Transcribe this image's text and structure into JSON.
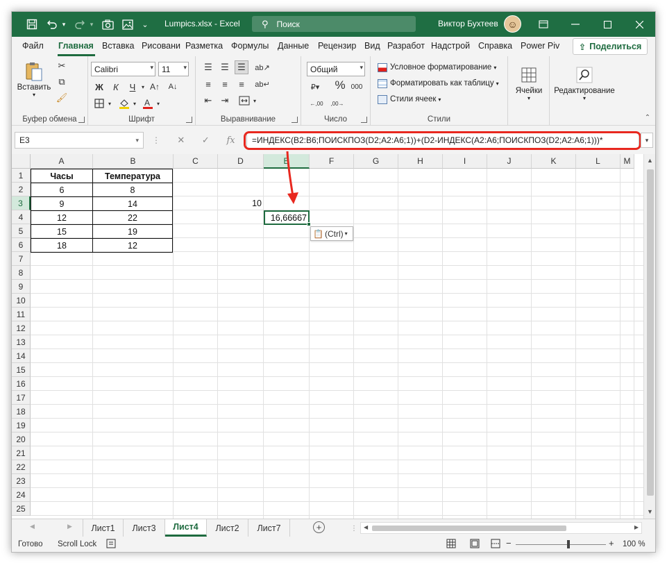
{
  "titlebar": {
    "doc_title": "Lumpics.xlsx  -  Excel",
    "search_placeholder": "Поиск",
    "user_name": "Виктор Бухтеев",
    "accent": "#1f6e43"
  },
  "menu": {
    "tabs": [
      "Файл",
      "Главная",
      "Вставка",
      "Рисовани",
      "Разметка",
      "Формулы",
      "Данные",
      "Рецензир",
      "Вид",
      "Разработ",
      "Надстрой",
      "Справка",
      "Power Piv"
    ],
    "active_tab": "Главная",
    "share_label": "Поделиться"
  },
  "ribbon": {
    "clipboard": {
      "paste_label": "Вставить",
      "group_label": "Буфер обмена"
    },
    "font": {
      "font_name": "Calibri",
      "font_size": "11",
      "bold": "Ж",
      "italic": "К",
      "underline": "Ч",
      "group_label": "Шрифт"
    },
    "alignment": {
      "group_label": "Выравнивание"
    },
    "number": {
      "format": "Общий",
      "group_label": "Число"
    },
    "styles": {
      "conditional": "Условное форматирование",
      "as_table": "Форматировать как таблицу",
      "cell_styles": "Стили ячеек",
      "group_label": "Стили"
    },
    "cells": {
      "label": "Ячейки"
    },
    "editing": {
      "label": "Редактирование"
    }
  },
  "formula_bar": {
    "name_box": "E3",
    "formula": "=ИНДЕКС(B2:B6;ПОИСКПОЗ(D2;A2:A6;1))+(D2-ИНДЕКС(A2:A6;ПОИСКПОЗ(D2;A2:A6;1)))*"
  },
  "grid": {
    "columns": [
      "A",
      "B",
      "C",
      "D",
      "E",
      "F",
      "G",
      "H",
      "I",
      "J",
      "K",
      "L",
      "M"
    ],
    "rows": [
      "1",
      "2",
      "3",
      "4",
      "5",
      "6",
      "7",
      "8",
      "9",
      "10",
      "11",
      "12",
      "13",
      "14",
      "15",
      "16",
      "17",
      "18",
      "19",
      "20",
      "21",
      "22",
      "23",
      "24",
      "25"
    ],
    "table_headers": [
      "Часы",
      "Температура"
    ],
    "table_rows": [
      [
        "6",
        "8"
      ],
      [
        "9",
        "14"
      ],
      [
        "12",
        "22"
      ],
      [
        "15",
        "19"
      ],
      [
        "18",
        "12"
      ]
    ],
    "d2_value": "10",
    "e3_value": "16,66667",
    "paste_options": "(Ctrl)"
  },
  "sheets": {
    "tabs": [
      "Лист1",
      "Лист3",
      "Лист4",
      "Лист2",
      "Лист7"
    ],
    "active": "Лист4"
  },
  "status": {
    "ready": "Готово",
    "scroll_lock": "Scroll Lock",
    "zoom": "100 %"
  }
}
